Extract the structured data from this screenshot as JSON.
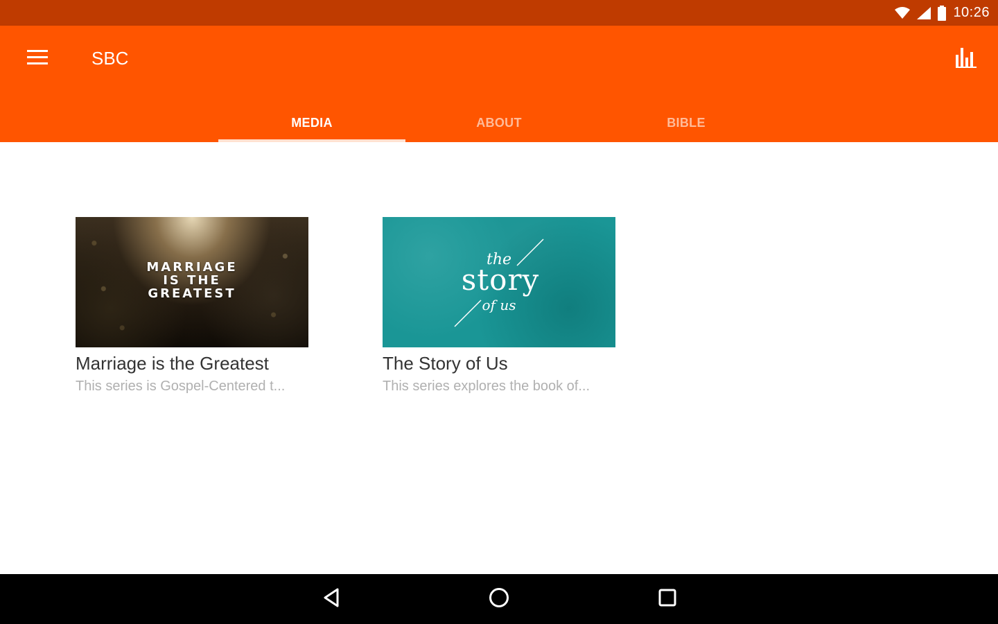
{
  "status_bar": {
    "time": "10:26",
    "icons": [
      "wifi-icon",
      "cell-signal-icon",
      "battery-icon"
    ]
  },
  "app_bar": {
    "title": "SBC",
    "menu_icon": "hamburger-menu-icon",
    "action_icon": "bar-chart-icon",
    "color": "#ff5500"
  },
  "tabs": [
    {
      "label": "MEDIA",
      "active": true
    },
    {
      "label": "ABOUT",
      "active": false
    },
    {
      "label": "BIBLE",
      "active": false
    }
  ],
  "media": {
    "items": [
      {
        "title": "Marriage is the Greatest",
        "subtitle": "This series is Gospel-Centered t...",
        "thumb_text": [
          "MARRIAGE",
          "IS THE",
          "GREATEST"
        ]
      },
      {
        "title": "The Story of Us",
        "subtitle": "This series explores the book of...",
        "thumb_text": [
          "the",
          "story",
          "of us"
        ]
      }
    ]
  },
  "nav_bar": {
    "icons": [
      "back-icon",
      "home-icon",
      "recent-apps-icon"
    ]
  },
  "colors": {
    "status_bar": "#bf3b00",
    "primary": "#ff5500",
    "tab_indicator": "#ffe2d1",
    "story_teal": "#1a9696"
  }
}
